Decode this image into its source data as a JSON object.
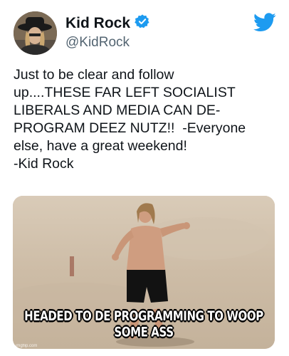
{
  "tweet": {
    "display_name": "Kid Rock",
    "handle": "@KidRock",
    "verified": true,
    "text": "Just to be clear and follow\nup....THESE FAR LEFT SOCIALIST\nLIBERALS AND MEDIA CAN DE-\nPROGRAM DEEZ NUTZ!!  -Everyone\nelse, have a great weekend!\n-Kid Rock"
  },
  "media": {
    "caption": "HEADED TO DE PROGRAMMING TO WOOP SOME ASS",
    "watermark": "imgflip.com"
  },
  "icons": {
    "brand": "twitter-bird-icon",
    "verified": "verified-badge-icon"
  },
  "colors": {
    "twitter_blue": "#1d9bf0",
    "text": "#0f1419",
    "secondary": "#536471"
  }
}
